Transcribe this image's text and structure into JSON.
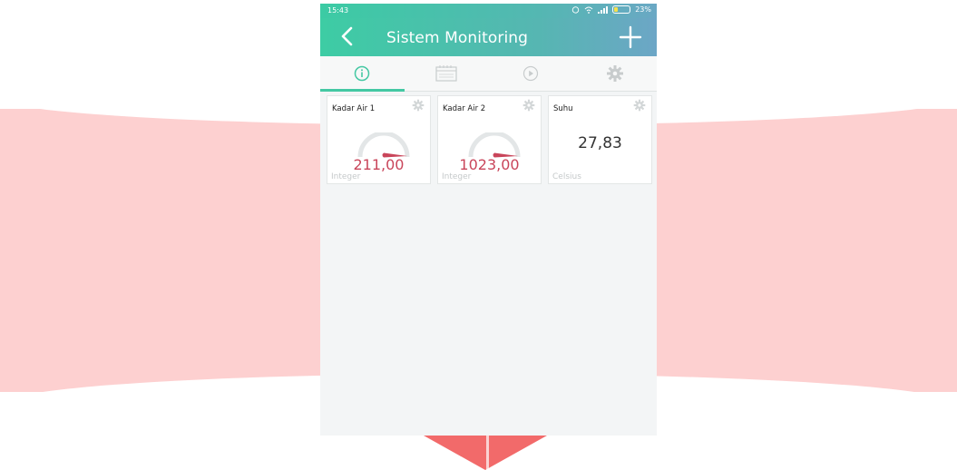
{
  "status_bar": {
    "time": "15:43",
    "battery_percent": "23%"
  },
  "app_bar": {
    "title": "Sistem Monitoring"
  },
  "tabs": [
    {
      "icon": "info-icon",
      "active": true
    },
    {
      "icon": "calendar-icon",
      "active": false
    },
    {
      "icon": "play-icon",
      "active": false
    },
    {
      "icon": "gear-icon",
      "active": false
    }
  ],
  "widgets": [
    {
      "title": "Kadar Air 1",
      "type": "gauge",
      "value": "211,00",
      "unit": "Integer"
    },
    {
      "title": "Kadar Air 2",
      "type": "gauge",
      "value": "1023,00",
      "unit": "Integer"
    },
    {
      "title": "Suhu",
      "type": "value",
      "value": "27,83",
      "unit": "Celsius"
    }
  ],
  "colors": {
    "accent": "#44c8a3",
    "gauge_needle": "#c9455a"
  }
}
